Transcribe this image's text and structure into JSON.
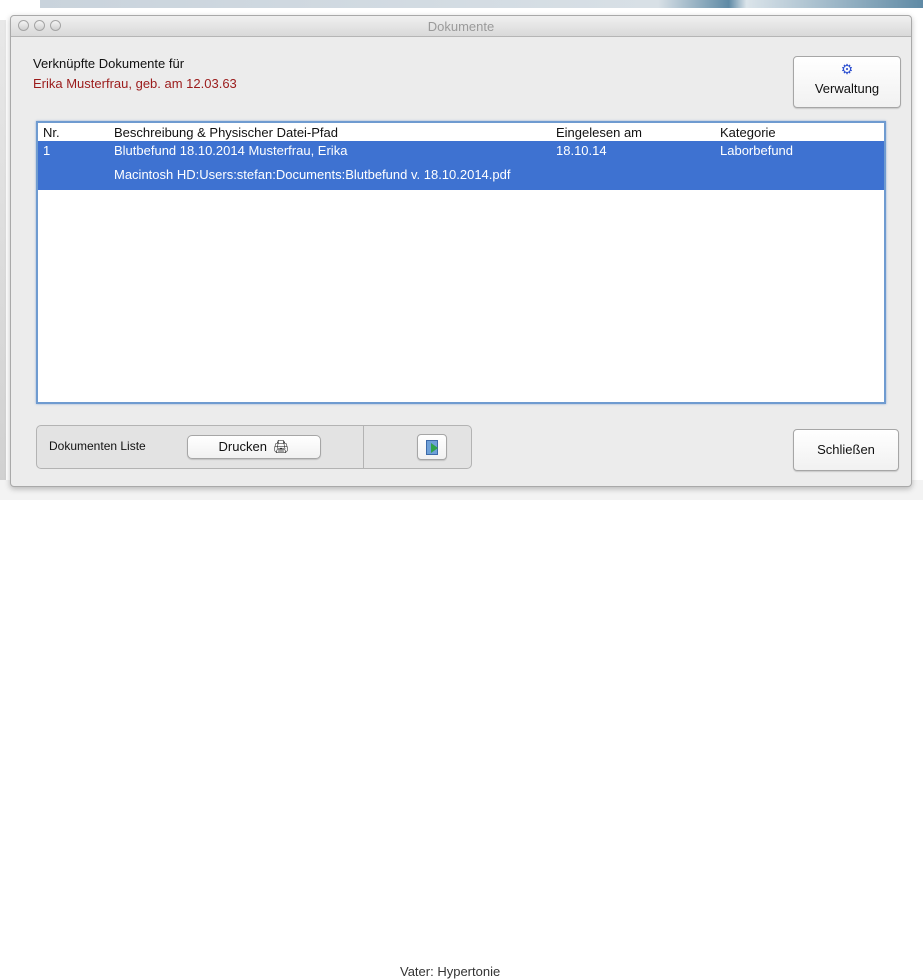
{
  "window": {
    "title": "Dokumente"
  },
  "header": {
    "line1": "Verknüpfte Dokumente für",
    "line2": "Erika Musterfrau, geb. am 12.03.63"
  },
  "buttons": {
    "verwaltung_label": "Verwaltung",
    "drucken_label": "Drucken",
    "schliessen_label": "Schließen"
  },
  "table": {
    "columns": [
      "Nr.",
      "Beschreibung & Physischer Datei-Pfad",
      "Eingelesen am",
      "Kategorie"
    ],
    "rows": [
      {
        "nr": "1",
        "beschreibung": "Blutbefund 18.10.2014 Musterfrau, Erika",
        "pfad": "Macintosh HD:Users:stefan:Documents:Blutbefund v. 18.10.2014.pdf",
        "eingelesen": "18.10.14",
        "kategorie": "Laborbefund"
      }
    ]
  },
  "bottom_group": {
    "label": "Dokumenten Liste"
  },
  "background": {
    "partial_text": "Vater: Hypertonie"
  },
  "icons": {
    "verwaltung": "gear-icon",
    "drucken": "printer-icon",
    "export": "document-export-icon"
  },
  "colors": {
    "selection": "#3e72d1",
    "patient_name": "#9b1b1b",
    "focus_ring": "#6f9bd0"
  }
}
